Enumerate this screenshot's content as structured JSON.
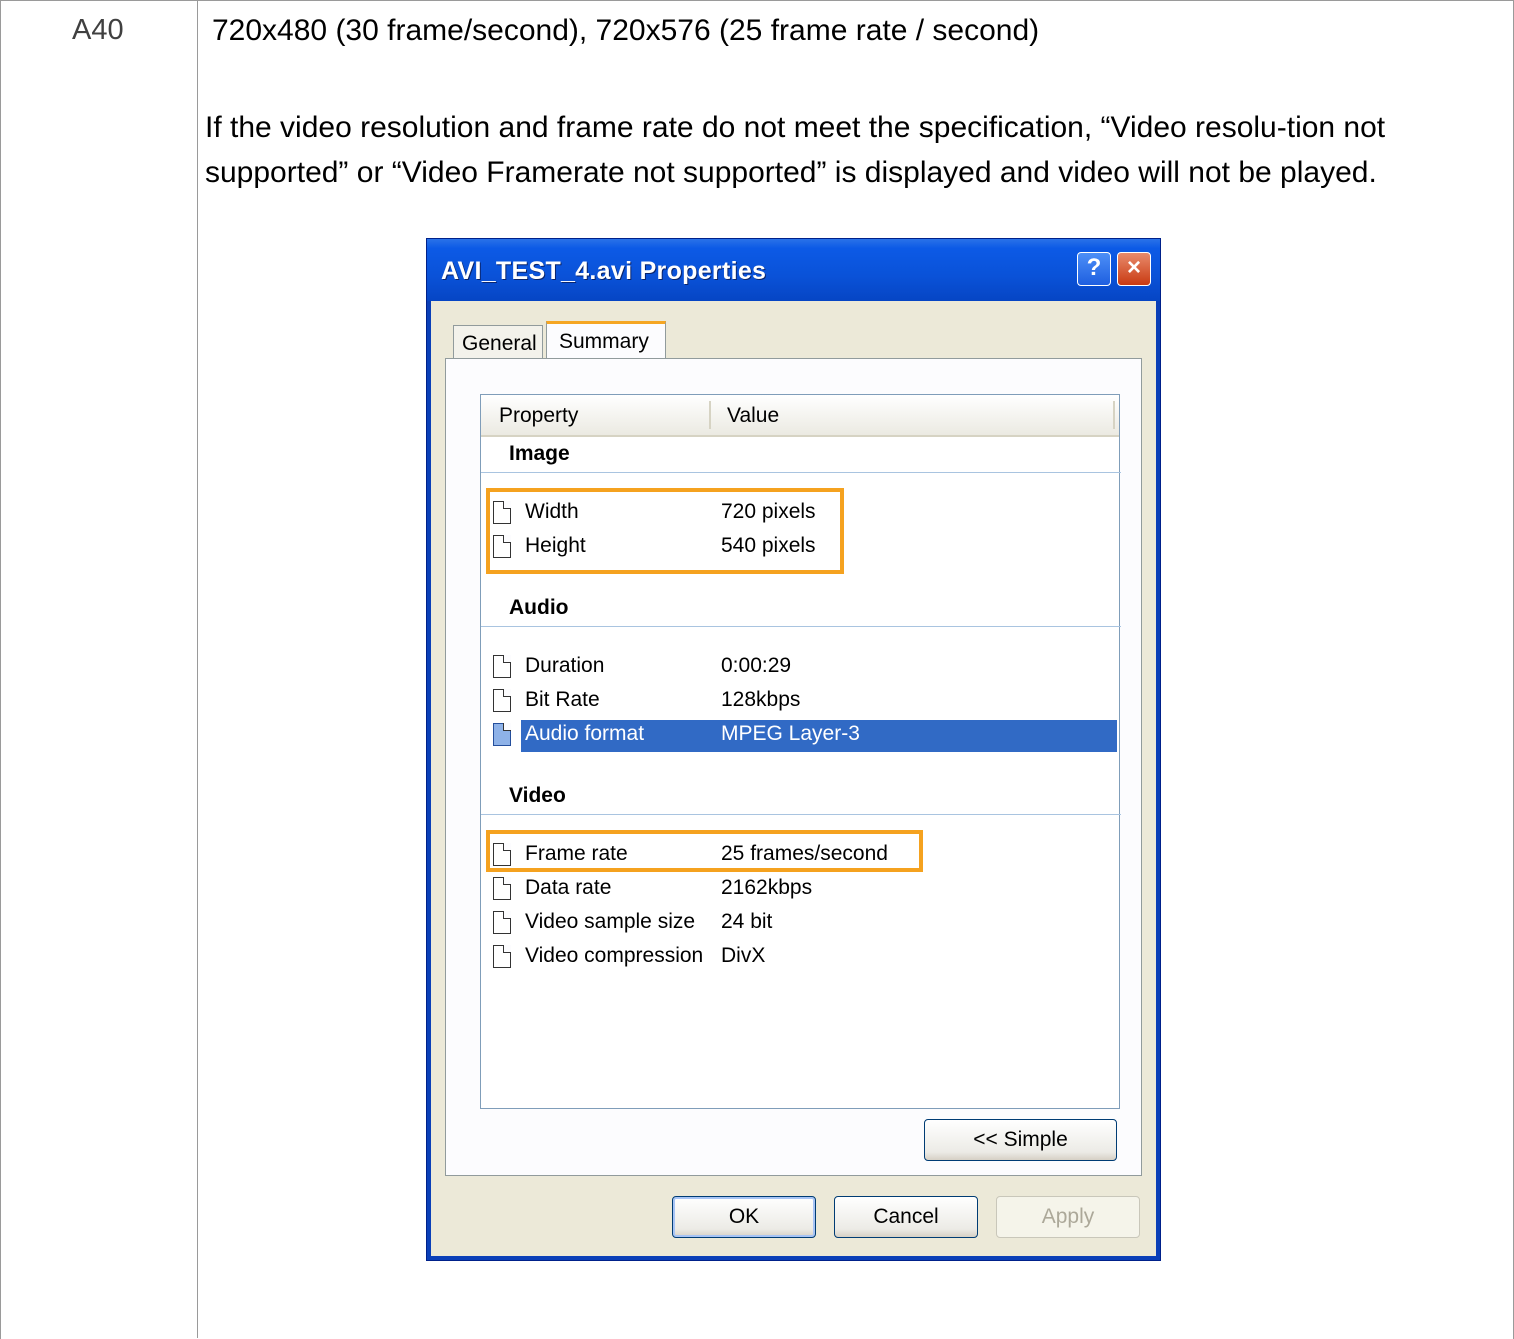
{
  "row_id": "A40",
  "heading": "720x480 (30 frame/second), 720x576 (25 frame rate / second)",
  "description": "If the video resolution and frame rate do not meet the specification, “Video resolu-tion not supported” or “Video Framerate not supported” is displayed and video will not be played.",
  "dialog": {
    "title": "AVI_TEST_4.avi Properties",
    "help_label": "?",
    "close_label": "×",
    "tabs": [
      "General",
      "Summary"
    ],
    "columns": [
      "Property",
      "Value"
    ],
    "groups": {
      "image": {
        "label": "Image",
        "rows": [
          {
            "property": "Width",
            "value": "720 pixels"
          },
          {
            "property": "Height",
            "value": "540 pixels"
          }
        ]
      },
      "audio": {
        "label": "Audio",
        "rows": [
          {
            "property": "Duration",
            "value": "0:00:29"
          },
          {
            "property": "Bit Rate",
            "value": "128kbps"
          },
          {
            "property": "Audio format",
            "value": "MPEG Layer-3"
          }
        ]
      },
      "video": {
        "label": "Video",
        "rows": [
          {
            "property": "Frame rate",
            "value": "25 frames/second"
          },
          {
            "property": "Data rate",
            "value": "2162kbps"
          },
          {
            "property": "Video sample size",
            "value": "24 bit"
          },
          {
            "property": "Video compression",
            "value": "DivX"
          }
        ]
      }
    },
    "simple_button": "<< Simple",
    "ok_button": "OK",
    "cancel_button": "Cancel",
    "apply_button": "Apply"
  },
  "colors": {
    "highlight": "#f5a21f",
    "selection": "#316ac5",
    "titlebar": "#0a52d8"
  }
}
